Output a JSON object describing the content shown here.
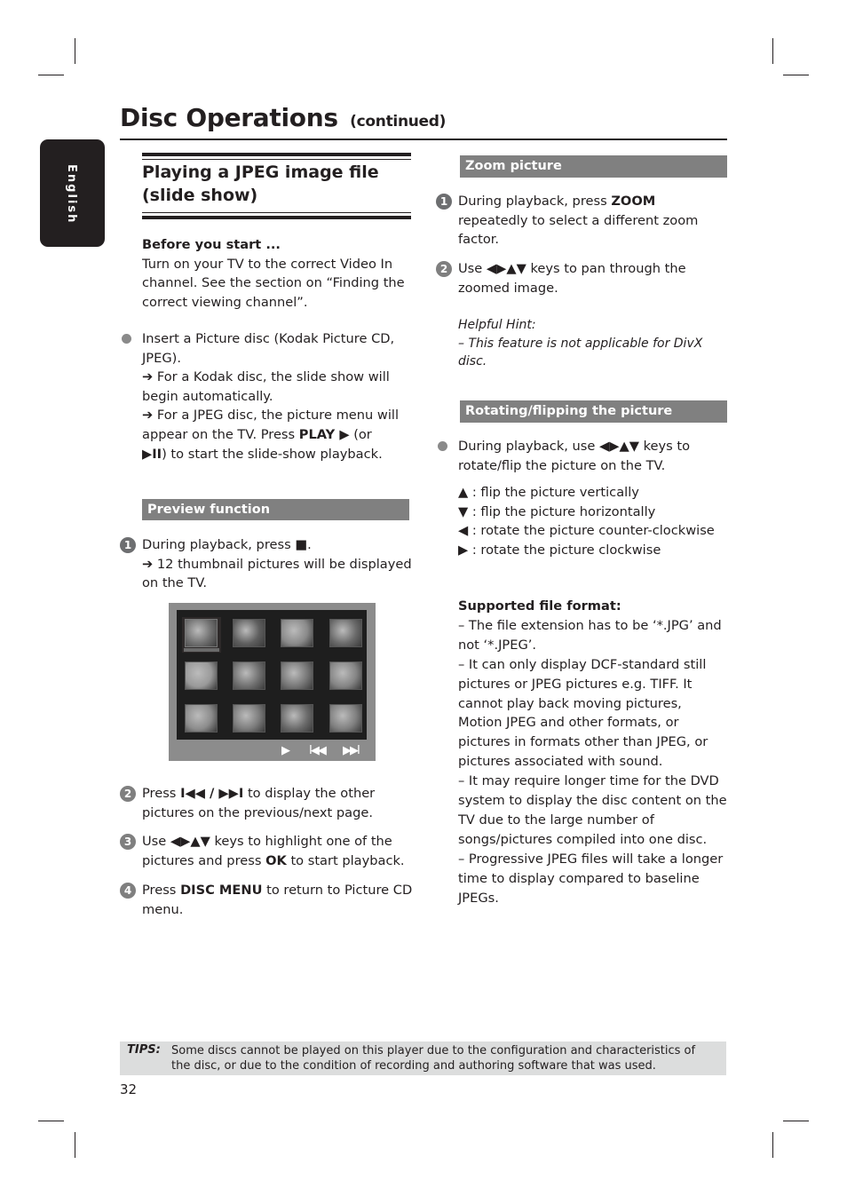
{
  "header": {
    "title": "Disc Operations",
    "continued": "(continued)"
  },
  "language_tab": "English",
  "left": {
    "section_title_line1": "Playing a JPEG image file",
    "section_title_line2": "(slide show)",
    "before_start_label": "Before you start ...",
    "before_start_text": "Turn on your TV to the correct Video In channel.  See the section on “Finding the correct viewing channel”.",
    "insert_step": {
      "text": "Insert a Picture disc (Kodak Picture CD, JPEG).",
      "kodak_note": "For a Kodak disc, the slide show will begin automatically.",
      "jpeg_note_pre": "For a JPEG disc, the picture menu will appear on the TV.  Press",
      "play_key": "PLAY ▶",
      "jpeg_note_mid": "(or",
      "play_pause_key": "▶II",
      "jpeg_note_post": ") to start the slide-show playback."
    },
    "preview_bar": "Preview function",
    "preview_steps": [
      {
        "num": "1",
        "pre": "During playback, press",
        "key": "■",
        "post": ".",
        "note": "12 thumbnail pictures will be displayed on the TV."
      },
      {
        "num": "2",
        "pre": "Press",
        "key": "I◀◀ / ▶▶I",
        "post": "to display the other pictures on the previous/next page."
      },
      {
        "num": "3",
        "pre": "Use",
        "key": "◀▶▲▼",
        "mid": "keys to highlight one of the pictures and press",
        "key2": "OK",
        "post": "to start playback."
      },
      {
        "num": "4",
        "pre": "Press",
        "key": "DISC MENU",
        "post": "to return to Picture CD menu."
      }
    ],
    "tv_preview": {
      "thumbnail_count": 12,
      "selected_index": 0,
      "controls": {
        "play": "▶",
        "prev": "I◀◀",
        "next": "▶▶I"
      }
    }
  },
  "right": {
    "zoom_bar": "Zoom picture",
    "zoom_steps": [
      {
        "num": "1",
        "pre": "During playback, press",
        "key": "ZOOM",
        "post": "repeatedly to select a different zoom factor."
      },
      {
        "num": "2",
        "pre": "Use",
        "key": "◀▶▲▼",
        "post": "keys to pan through the zoomed image."
      }
    ],
    "hint_label": "Helpful Hint:",
    "hint_text": "–  This feature is not applicable for DivX disc.",
    "rotate_bar": "Rotating/flipping the picture",
    "rotate_intro_pre": "During playback, use",
    "rotate_intro_keys": "◀▶▲▼",
    "rotate_intro_post": "keys to rotate/flip the picture on the TV.",
    "rotate_items": [
      {
        "key": "▲",
        "text": " : flip the picture vertically"
      },
      {
        "key": "▼",
        "text": " : flip the picture horizontally"
      },
      {
        "key": "◀",
        "text": " : rotate the picture counter-clockwise"
      },
      {
        "key": "▶",
        "text": " : rotate the picture clockwise"
      }
    ],
    "supported_label": "Supported file format:",
    "supported_items": [
      "–   The file extension has to be ‘*.JPG’ and not ‘*.JPEG’.",
      "–   It can only display DCF-standard still pictures or JPEG pictures e.g. TIFF.  It cannot play back moving pictures, Motion JPEG and other formats, or pictures in formats other than JPEG, or pictures associated with sound.",
      "–   It may require longer time for the DVD system to display the disc content on the TV due to the large number of songs/pictures compiled into one disc.",
      "–   Progressive JPEG files will take a longer time to display compared to baseline JPEGs."
    ]
  },
  "tips": {
    "label": "TIPS:",
    "text": "Some discs cannot be played on this player due to the configuration and characteristics of the disc, or due to the condition of recording and authoring software that was used."
  },
  "page_number": "32"
}
